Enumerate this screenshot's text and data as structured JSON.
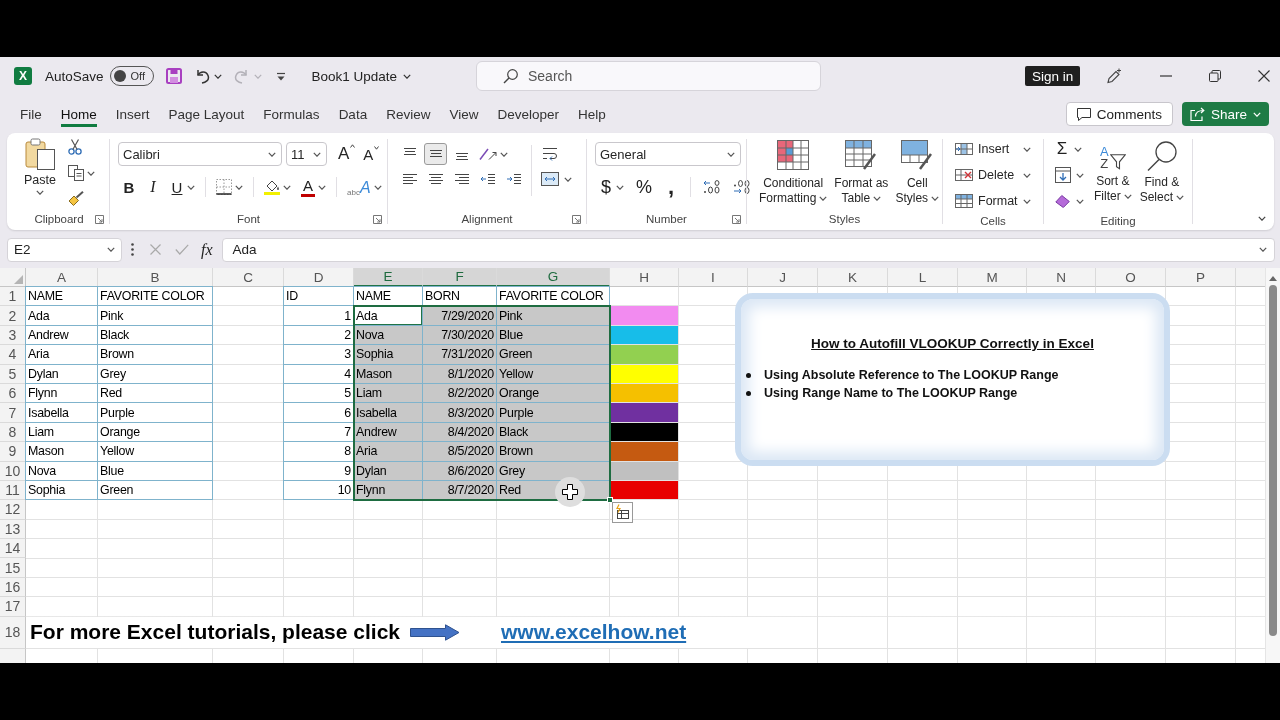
{
  "title_bar": {
    "logo": "X",
    "autosave": {
      "label": "AutoSave",
      "state": "Off",
      "on": false
    },
    "quick_access": [
      {
        "kind": "save",
        "disabled": false
      },
      {
        "kind": "undo",
        "disabled": false
      },
      {
        "kind": "redo",
        "disabled": true
      }
    ],
    "document_title": "Book1 Update",
    "search": {
      "placeholder": "Search"
    },
    "sign_in": "Sign in"
  },
  "menu_tabs": [
    {
      "label": "File",
      "selected": false
    },
    {
      "label": "Home",
      "selected": true
    },
    {
      "label": "Insert",
      "selected": false
    },
    {
      "label": "Page Layout",
      "selected": false
    },
    {
      "label": "Formulas",
      "selected": false
    },
    {
      "label": "Data",
      "selected": false
    },
    {
      "label": "Review",
      "selected": false
    },
    {
      "label": "View",
      "selected": false
    },
    {
      "label": "Developer",
      "selected": false
    },
    {
      "label": "Help",
      "selected": false
    }
  ],
  "comments_button": "Comments",
  "share_button": "Share",
  "ribbon": {
    "clipboard": {
      "label": "Clipboard",
      "paste": "Paste"
    },
    "font": {
      "label": "Font",
      "font_name": "Calibri",
      "font_size": "11",
      "size_buttons": [
        {
          "kind": "grow",
          "glyph": "A"
        },
        {
          "kind": "shrink",
          "glyph": "A"
        }
      ],
      "style_buttons": [
        {
          "kind": "bold",
          "glyph": "B"
        },
        {
          "kind": "italic",
          "glyph": "I"
        },
        {
          "kind": "underline",
          "glyph": "U"
        }
      ],
      "font_color": "A",
      "text_effects": {
        "small": "abc",
        "glyph": "A"
      }
    },
    "alignment": {
      "label": "Alignment",
      "vertical": [
        {
          "kind": "top",
          "selected": false
        },
        {
          "kind": "middle",
          "selected": true
        },
        {
          "kind": "bottom",
          "selected": false
        }
      ]
    },
    "number": {
      "label": "Number",
      "format": "General",
      "buttons": [
        {
          "kind": "currency",
          "glyph": "$"
        },
        {
          "kind": "percent",
          "glyph": "%"
        },
        {
          "kind": "comma",
          "glyph": ","
        }
      ]
    },
    "styles": {
      "label": "Styles",
      "buttons": [
        {
          "kind": "conditional-formatting",
          "lines": [
            "Conditional",
            "Formatting"
          ]
        },
        {
          "kind": "format-as-table",
          "lines": [
            "Format as",
            "Table"
          ]
        },
        {
          "kind": "cell-styles",
          "lines": [
            "Cell",
            "Styles"
          ]
        }
      ]
    },
    "cells": {
      "label": "Cells",
      "buttons": [
        {
          "kind": "insert",
          "label": "Insert"
        },
        {
          "kind": "delete",
          "label": "Delete"
        },
        {
          "kind": "format",
          "label": "Format"
        }
      ]
    },
    "editing": {
      "label": "Editing",
      "autosum": "Σ",
      "sort_letters": [
        "A",
        "Z"
      ],
      "big_buttons": [
        {
          "kind": "sort-filter",
          "lines": [
            "Sort &",
            "Filter"
          ]
        },
        {
          "kind": "find-select",
          "lines": [
            "Find &",
            "Select"
          ]
        }
      ]
    }
  },
  "formula_bar": {
    "name_box": "E2",
    "function_label": "fx",
    "value": "Ada"
  },
  "sheet": {
    "columns": [
      {
        "label": "A",
        "selected": false
      },
      {
        "label": "B",
        "selected": false
      },
      {
        "label": "C",
        "selected": false
      },
      {
        "label": "D",
        "selected": false
      },
      {
        "label": "E",
        "selected": true
      },
      {
        "label": "F",
        "selected": true
      },
      {
        "label": "G",
        "selected": true
      },
      {
        "label": "H",
        "selected": false
      },
      {
        "label": "I",
        "selected": false
      },
      {
        "label": "J",
        "selected": false
      },
      {
        "label": "K",
        "selected": false
      },
      {
        "label": "L",
        "selected": false
      },
      {
        "label": "M",
        "selected": false
      },
      {
        "label": "N",
        "selected": false
      },
      {
        "label": "O",
        "selected": false
      },
      {
        "label": "P",
        "selected": false
      }
    ],
    "row_labels": [
      "1",
      "2",
      "3",
      "4",
      "5",
      "6",
      "7",
      "8",
      "9",
      "10",
      "11",
      "12",
      "13",
      "14",
      "15",
      "16",
      "17",
      "18"
    ],
    "table_1": {
      "columns": [
        "NAME",
        "FAVORITE COLOR"
      ],
      "rows": [
        [
          "Ada",
          "Pink"
        ],
        [
          "Andrew",
          "Black"
        ],
        [
          "Aria",
          "Brown"
        ],
        [
          "Dylan",
          "Grey"
        ],
        [
          "Flynn",
          "Red"
        ],
        [
          "Isabella",
          "Purple"
        ],
        [
          "Liam",
          "Orange"
        ],
        [
          "Mason",
          "Yellow"
        ],
        [
          "Nova",
          "Blue"
        ],
        [
          "Sophia",
          "Green"
        ]
      ]
    },
    "table_2": {
      "columns": [
        {
          "label": "ID",
          "kind": "number"
        },
        {
          "label": "NAME",
          "kind": "text"
        },
        {
          "label": "BORN",
          "kind": "number"
        },
        {
          "label": "FAVORITE COLOR",
          "kind": "text"
        }
      ],
      "rows": [
        {
          "cells": [
            {
              "text": "1",
              "selected": false,
              "active": false
            },
            {
              "text": "Ada",
              "selected": true,
              "active": true
            },
            {
              "text": "7/29/2020",
              "selected": true,
              "active": false
            },
            {
              "text": "Pink",
              "selected": true,
              "active": false
            }
          ]
        },
        {
          "cells": [
            {
              "text": "2",
              "selected": false,
              "active": false
            },
            {
              "text": "Nova",
              "selected": true,
              "active": false
            },
            {
              "text": "7/30/2020",
              "selected": true,
              "active": false
            },
            {
              "text": "Blue",
              "selected": true,
              "active": false
            }
          ]
        },
        {
          "cells": [
            {
              "text": "3",
              "selected": false,
              "active": false
            },
            {
              "text": "Sophia",
              "selected": true,
              "active": false
            },
            {
              "text": "7/31/2020",
              "selected": true,
              "active": false
            },
            {
              "text": "Green",
              "selected": true,
              "active": false
            }
          ]
        },
        {
          "cells": [
            {
              "text": "4",
              "selected": false,
              "active": false
            },
            {
              "text": "Mason",
              "selected": true,
              "active": false
            },
            {
              "text": "8/1/2020",
              "selected": true,
              "active": false
            },
            {
              "text": "Yellow",
              "selected": true,
              "active": false
            }
          ]
        },
        {
          "cells": [
            {
              "text": "5",
              "selected": false,
              "active": false
            },
            {
              "text": "Liam",
              "selected": true,
              "active": false
            },
            {
              "text": "8/2/2020",
              "selected": true,
              "active": false
            },
            {
              "text": "Orange",
              "selected": true,
              "active": false
            }
          ]
        },
        {
          "cells": [
            {
              "text": "6",
              "selected": false,
              "active": false
            },
            {
              "text": "Isabella",
              "selected": true,
              "active": false
            },
            {
              "text": "8/3/2020",
              "selected": true,
              "active": false
            },
            {
              "text": "Purple",
              "selected": true,
              "active": false
            }
          ]
        },
        {
          "cells": [
            {
              "text": "7",
              "selected": false,
              "active": false
            },
            {
              "text": "Andrew",
              "selected": true,
              "active": false
            },
            {
              "text": "8/4/2020",
              "selected": true,
              "active": false
            },
            {
              "text": "Black",
              "selected": true,
              "active": false
            }
          ]
        },
        {
          "cells": [
            {
              "text": "8",
              "selected": false,
              "active": false
            },
            {
              "text": "Aria",
              "selected": true,
              "active": false
            },
            {
              "text": "8/5/2020",
              "selected": true,
              "active": false
            },
            {
              "text": "Brown",
              "selected": true,
              "active": false
            }
          ]
        },
        {
          "cells": [
            {
              "text": "9",
              "selected": false,
              "active": false
            },
            {
              "text": "Dylan",
              "selected": true,
              "active": false
            },
            {
              "text": "8/6/2020",
              "selected": true,
              "active": false
            },
            {
              "text": "Grey",
              "selected": true,
              "active": false
            }
          ]
        },
        {
          "cells": [
            {
              "text": "10",
              "selected": false,
              "active": false
            },
            {
              "text": "Flynn",
              "selected": true,
              "active": false
            },
            {
              "text": "8/7/2020",
              "selected": true,
              "active": false
            },
            {
              "text": "Red",
              "selected": true,
              "active": false
            }
          ]
        }
      ]
    },
    "swatches": [
      {
        "color": "#f28bf0"
      },
      {
        "color": "#17bde9"
      },
      {
        "color": "#92d050"
      },
      {
        "color": "#ffff00"
      },
      {
        "color": "#f5c000"
      },
      {
        "color": "#7030a0"
      },
      {
        "color": "#000000"
      },
      {
        "color": "#c55a11"
      },
      {
        "color": "#c0c0c0"
      },
      {
        "color": "#e80000"
      }
    ],
    "text_box": {
      "title": "How to Autofill VLOOKUP Correctly in Excel",
      "bullets": [
        "Using Absolute Reference to The LOOKUP Range",
        "Using Range Name to The LOOKUP Range"
      ]
    },
    "footer": {
      "text": "For more Excel tutorials, please click",
      "link": "www.excelhow.net"
    }
  }
}
